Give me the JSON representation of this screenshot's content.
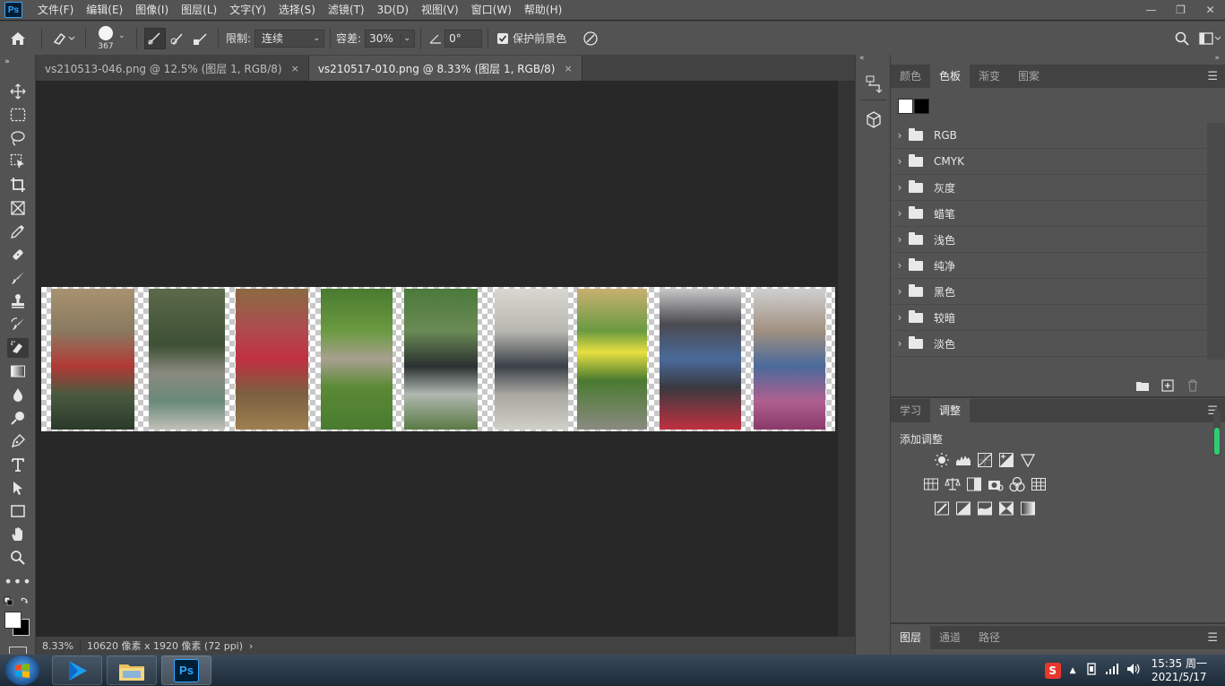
{
  "menu": {
    "logo": "Ps",
    "items": [
      "文件(F)",
      "编辑(E)",
      "图像(I)",
      "图层(L)",
      "文字(Y)",
      "选择(S)",
      "滤镜(T)",
      "3D(D)",
      "视图(V)",
      "窗口(W)",
      "帮助(H)"
    ]
  },
  "options": {
    "brush_size": "367",
    "limit_label": "限制:",
    "limit_value": "连续",
    "tolerance_label": "容差:",
    "tolerance_value": "30%",
    "angle_value": "0°",
    "protect_label": "保护前景色",
    "protect_checked": true
  },
  "tabs": [
    {
      "label": "vs210513-046.png @ 12.5% (图层 1, RGB/8)",
      "close": "×"
    },
    {
      "label": "vs210517-010.png @ 8.33% (图层 1, RGB/8)",
      "close": "×"
    }
  ],
  "status": {
    "zoom": "8.33%",
    "info": "10620 像素 x 1920 像素 (72 ppi)",
    "arrow": "›"
  },
  "swatches_panel": {
    "tabs": [
      "颜色",
      "色板",
      "渐变",
      "图案"
    ],
    "active_tab": 1,
    "folders": [
      "RGB",
      "CMYK",
      "灰度",
      "蜡笔",
      "浅色",
      "纯净",
      "黑色",
      "较暗",
      "淡色"
    ]
  },
  "adjust_panel": {
    "tabs": [
      "学习",
      "调整"
    ],
    "active_tab": 1,
    "title": "添加调整"
  },
  "layers_panel": {
    "tabs": [
      "图层",
      "通道",
      "路径"
    ]
  },
  "taskbar": {
    "time": "15:35 周一",
    "date": "2021/5/17",
    "ps_label": "Ps",
    "ime_label": "S"
  },
  "colors": {
    "ps_blue": "#31a8ff",
    "panel_bg": "#535353",
    "canvas_bg": "#282828"
  }
}
